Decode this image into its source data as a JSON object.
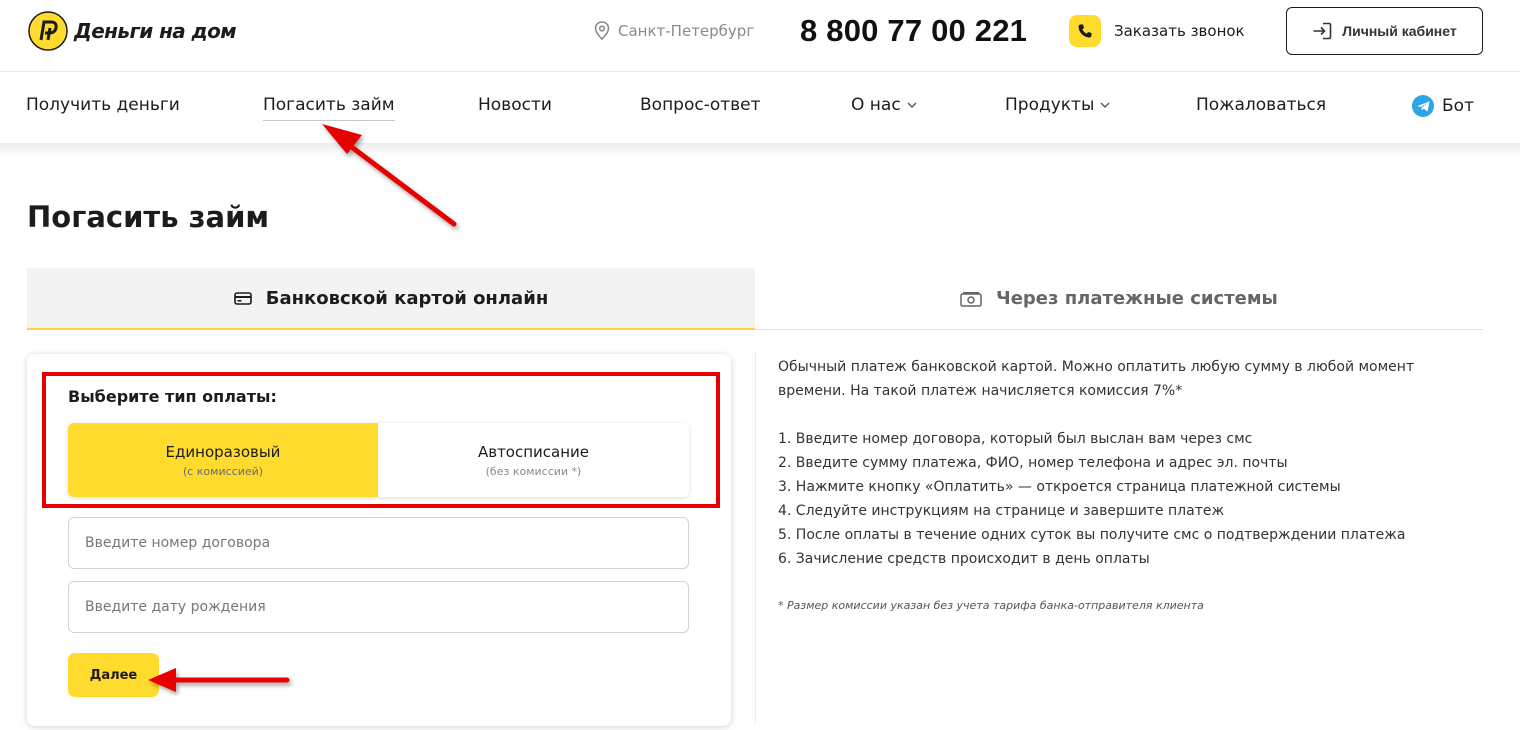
{
  "header": {
    "logo_text": "Деньги на дом",
    "city": "Санкт-Петербург",
    "phone": "8 800 77 00 221",
    "callback_label": "Заказать звонок",
    "cabinet_label": "Личный кабинет"
  },
  "nav": {
    "items": [
      {
        "label": "Получить деньги"
      },
      {
        "label": "Погасить займ",
        "active": true
      },
      {
        "label": "Новости"
      },
      {
        "label": "Вопрос-ответ"
      },
      {
        "label": "О нас",
        "dropdown": true
      },
      {
        "label": "Продукты",
        "dropdown": true
      },
      {
        "label": "Пожаловаться"
      },
      {
        "label": "Бот",
        "icon": "telegram-icon"
      }
    ]
  },
  "page": {
    "title": "Погасить займ"
  },
  "tabs": [
    {
      "label": "Банковской картой онлайн",
      "icon": "card-icon",
      "active": true
    },
    {
      "label": "Через платежные системы",
      "icon": "cash-icon",
      "active": false
    }
  ],
  "form": {
    "type_label": "Выберите тип оплаты:",
    "types": [
      {
        "label": "Единоразовый",
        "sub": "(с комиссией)",
        "selected": true
      },
      {
        "label": "Автосписание",
        "sub": "(без комиссии *)",
        "selected": false
      }
    ],
    "contract_placeholder": "Введите номер договора",
    "birth_placeholder": "Введите дату рождения",
    "submit_label": "Далее"
  },
  "info": {
    "intro": "Обычный платеж банковской картой. Можно оплатить любую сумму в любой момент времени. На такой платеж начисляется комиссия 7%*",
    "steps": [
      "1. Введите номер договора, который был выслан вам через смс",
      "2. Введите сумму платежа, ФИО, номер телефона и адрес эл. почты",
      "3. Нажмите кнопку «Оплатить» — откроется страница платежной системы",
      "4. Следуйте инструкциям на странице и завершите платеж",
      "5. После оплаты в течение одних суток вы получите смс о подтверждении платежа",
      "6. Зачисление средств происходит в день оплаты"
    ],
    "note": "* Размер комиссии указан без учета тарифа банка-отправителя клиента"
  },
  "colors": {
    "accent": "#ffdb2d",
    "annotation": "#e60000",
    "telegram": "#2ea6e3"
  }
}
